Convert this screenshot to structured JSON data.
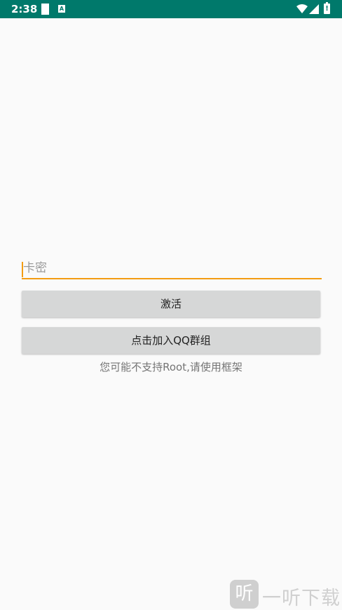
{
  "status_bar": {
    "time": "2:38",
    "notification_icon": "A",
    "background_color": "#00796b"
  },
  "form": {
    "card_key_placeholder": "卡密",
    "activate_label": "激活",
    "join_qq_label": "点击加入QQ群组",
    "hint_text": "您可能不支持Root,请使用框架",
    "accent_color": "#f39c12"
  },
  "watermark": {
    "logo_char": "听",
    "text": "一听下载"
  }
}
